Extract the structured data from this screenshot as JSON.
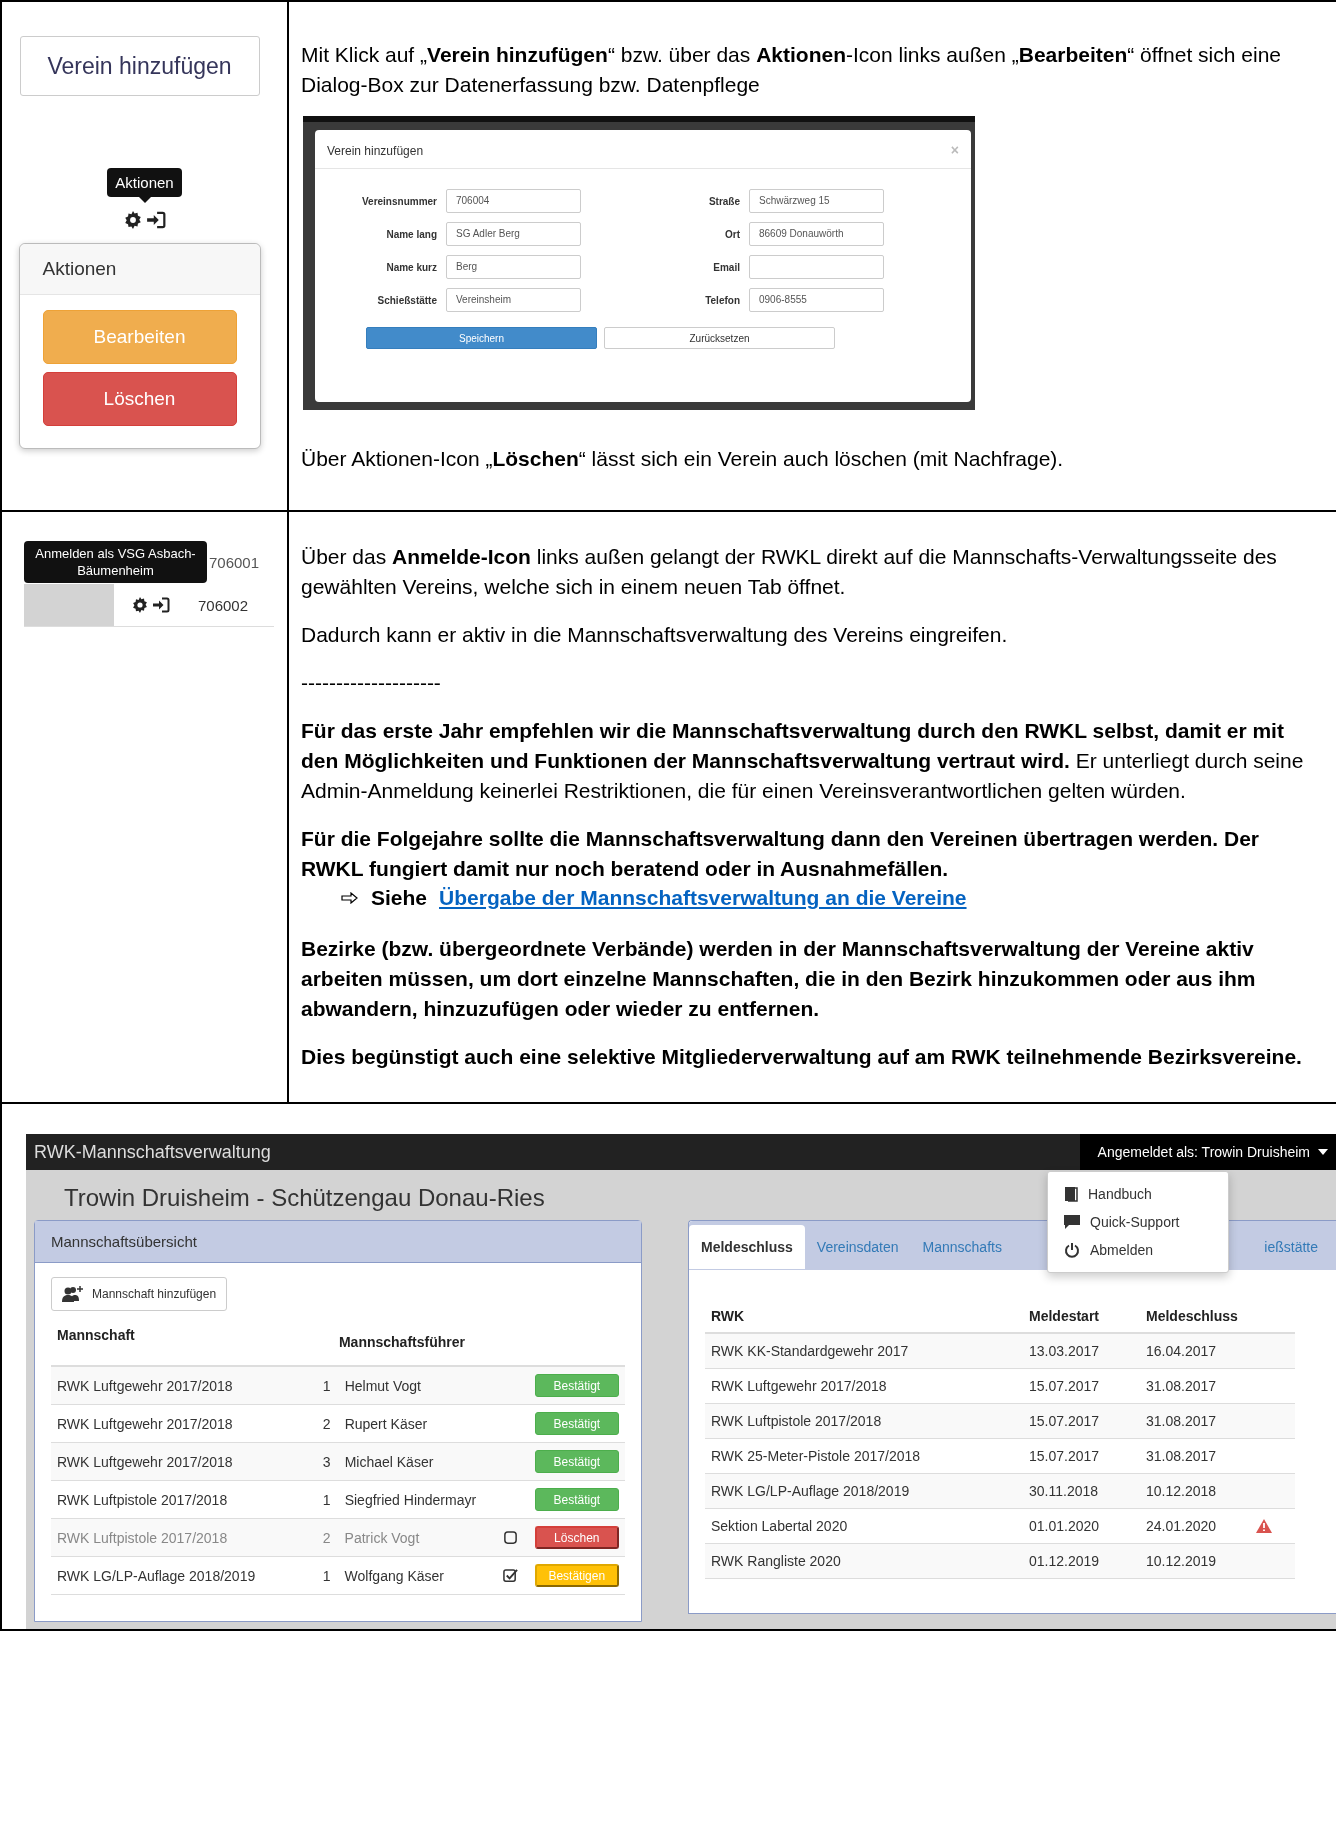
{
  "club_section": {
    "add_button": "Verein hinzufügen",
    "tooltip": "Aktionen",
    "popover": {
      "title": "Aktionen",
      "buttons": [
        {
          "label": "Bearbeiten",
          "kind": "warning"
        },
        {
          "label": "Löschen",
          "kind": "danger"
        }
      ]
    },
    "intro": "Mit Klick auf „**Verein hinzufügen**“ bzw. über das **Aktionen**-Icon links außen „**Bearbeiten**“ öffnet sich eine Dialog-Box zur Datenerfassung bzw. Datenpflege",
    "dialog": {
      "title": "Verein hinzufügen",
      "close": "×",
      "fields": [
        {
          "label": "Vereinsnummer",
          "value": "706004"
        },
        {
          "label": "Straße",
          "value": "Schwärzweg 15"
        },
        {
          "label": "Name lang",
          "value": "SG Adler Berg"
        },
        {
          "label": "Ort",
          "value": "86609 Donauwörth"
        },
        {
          "label": "Name kurz",
          "value": "Berg"
        },
        {
          "label": "Email"
        },
        {
          "label": "Schießstätte",
          "value": "Vereinsheim"
        },
        {
          "label": "Telefon",
          "value": "0906-8555"
        }
      ],
      "buttons": [
        {
          "label": "Speichern",
          "kind": "primary"
        },
        {
          "label": "Zurücksetzen",
          "kind": "default"
        }
      ]
    },
    "delete_note": "Über Aktionen-Icon „**Löschen**“ lässt sich ein Verein auch löschen (mit Nachfrage)."
  },
  "login_section": {
    "tooltip": "Anmelden als VSG Asbach-Bäumenheim",
    "numbers": [
      "706001",
      "706002"
    ],
    "paragraphs": [
      {
        "kind": "text",
        "text": "Über das **Anmelde-Icon** links außen gelangt der RWKL direkt auf die Mannschafts-Verwaltungsseite des gewählten Vereins, welche sich in einem neuen Tab öffnet."
      },
      {
        "kind": "text",
        "text": "Dadurch kann er aktiv in die Mannschaftsverwaltung des Vereins eingreifen."
      },
      {
        "kind": "rule",
        "text": "--------------------"
      },
      {
        "kind": "text",
        "text": "**Für das erste Jahr empfehlen wir die Mannschaftsverwaltung durch den RWKL selbst, damit er mit den Möglichkeiten und Funktionen der Mannschaftsverwaltung vertraut wird.** Er unterliegt durch seine Admin-Anmeldung keinerlei Restriktionen, die für einen Vereinsverantwortlichen gelten würden."
      },
      {
        "kind": "bold",
        "text": "Für die Folgejahre sollte die Mannschaftsverwaltung dann den Vereinen übertragen werden. Der RWKL fungiert damit nur noch beratend oder in Ausnahmefällen."
      },
      {
        "kind": "see",
        "text": "Siehe",
        "link": "Übergabe der Mannschaftsverwaltung an die Vereine"
      },
      {
        "kind": "bold",
        "text": "Bezirke (bzw. übergeordnete Verbände) werden in der Mannschaftsverwaltung der Vereine aktiv arbeiten müssen, um dort einzelne Mannschaften, die in den Bezirk hinzukommen oder aus ihm abwandern, hinzuzufügen oder wieder zu entfernen."
      },
      {
        "kind": "bold",
        "text": "Dies begünstigt auch eine selektive Mitgliederverwaltung auf am RWK teilnehmende Bezirksvereine."
      }
    ]
  },
  "app": {
    "brand": "RWK-Mannschaftsverwaltung",
    "user_menu": "Angemeldet als: Trowin Druisheim",
    "menu_items": [
      {
        "label": "Handbuch"
      },
      {
        "label": "Quick-Support"
      },
      {
        "label": "Abmelden"
      }
    ],
    "heading": "Trowin Druisheim - Schützengau Donau-Ries",
    "teams": {
      "title": "Mannschaftsübersicht",
      "add_button": "Mannschaft hinzufügen",
      "columns": [
        "Mannschaft",
        "Mannschaftsführer"
      ],
      "rows": [
        {
          "team": "RWK Luftgewehr 2017/2018",
          "number": "1",
          "leader": "Helmut Vogt",
          "disabled": false,
          "status": {
            "label": "Bestätigt",
            "kind": "success"
          }
        },
        {
          "team": "RWK Luftgewehr 2017/2018",
          "number": "2",
          "leader": "Rupert Käser",
          "disabled": false,
          "status": {
            "label": "Bestätigt",
            "kind": "success"
          }
        },
        {
          "team": "RWK Luftgewehr 2017/2018",
          "number": "3",
          "leader": "Michael Käser",
          "disabled": false,
          "status": {
            "label": "Bestätigt",
            "kind": "success"
          }
        },
        {
          "team": "RWK Luftpistole 2017/2018",
          "number": "1",
          "leader": "Siegfried Hindermayr",
          "disabled": false,
          "status": {
            "label": "Bestätigt",
            "kind": "success"
          }
        },
        {
          "team": "RWK Luftpistole 2017/2018",
          "number": "2",
          "leader": "Patrick Vogt",
          "disabled": true,
          "checked": false,
          "status": {
            "label": "Löschen",
            "kind": "danger"
          }
        },
        {
          "team": "RWK LG/LP-Auflage 2018/2019",
          "number": "1",
          "leader": "Wolfgang Käser",
          "disabled": false,
          "checked": true,
          "status": {
            "label": "Bestätigen",
            "kind": "warning"
          }
        }
      ]
    },
    "tabs": [
      {
        "label": "Meldeschluss",
        "selected": true
      },
      {
        "label": "Vereinsdaten",
        "selected": false
      },
      {
        "label": "Mannschafts",
        "selected": false
      },
      {
        "label": "ießstätte",
        "selected": false
      }
    ],
    "deadlines": {
      "columns": [
        "RWK",
        "Meldestart",
        "Meldeschluss"
      ],
      "rows": [
        {
          "name": "RWK KK-Standardgewehr 2017",
          "start": "13.03.2017",
          "end": "16.04.2017",
          "warning": false
        },
        {
          "name": "RWK Luftgewehr 2017/2018",
          "start": "15.07.2017",
          "end": "31.08.2017",
          "warning": false
        },
        {
          "name": "RWK Luftpistole 2017/2018",
          "start": "15.07.2017",
          "end": "31.08.2017",
          "warning": false
        },
        {
          "name": "RWK 25-Meter-Pistole 2017/2018",
          "start": "15.07.2017",
          "end": "31.08.2017",
          "warning": false
        },
        {
          "name": "RWK LG/LP-Auflage 2018/2019",
          "start": "30.11.2018",
          "end": "10.12.2018",
          "warning": false
        },
        {
          "name": "Sektion Labertal 2020",
          "start": "01.01.2020",
          "end": "24.01.2020",
          "warning": true
        },
        {
          "name": "RWK Rangliste 2020",
          "start": "01.12.2019",
          "end": "10.12.2019",
          "warning": false
        }
      ]
    }
  }
}
